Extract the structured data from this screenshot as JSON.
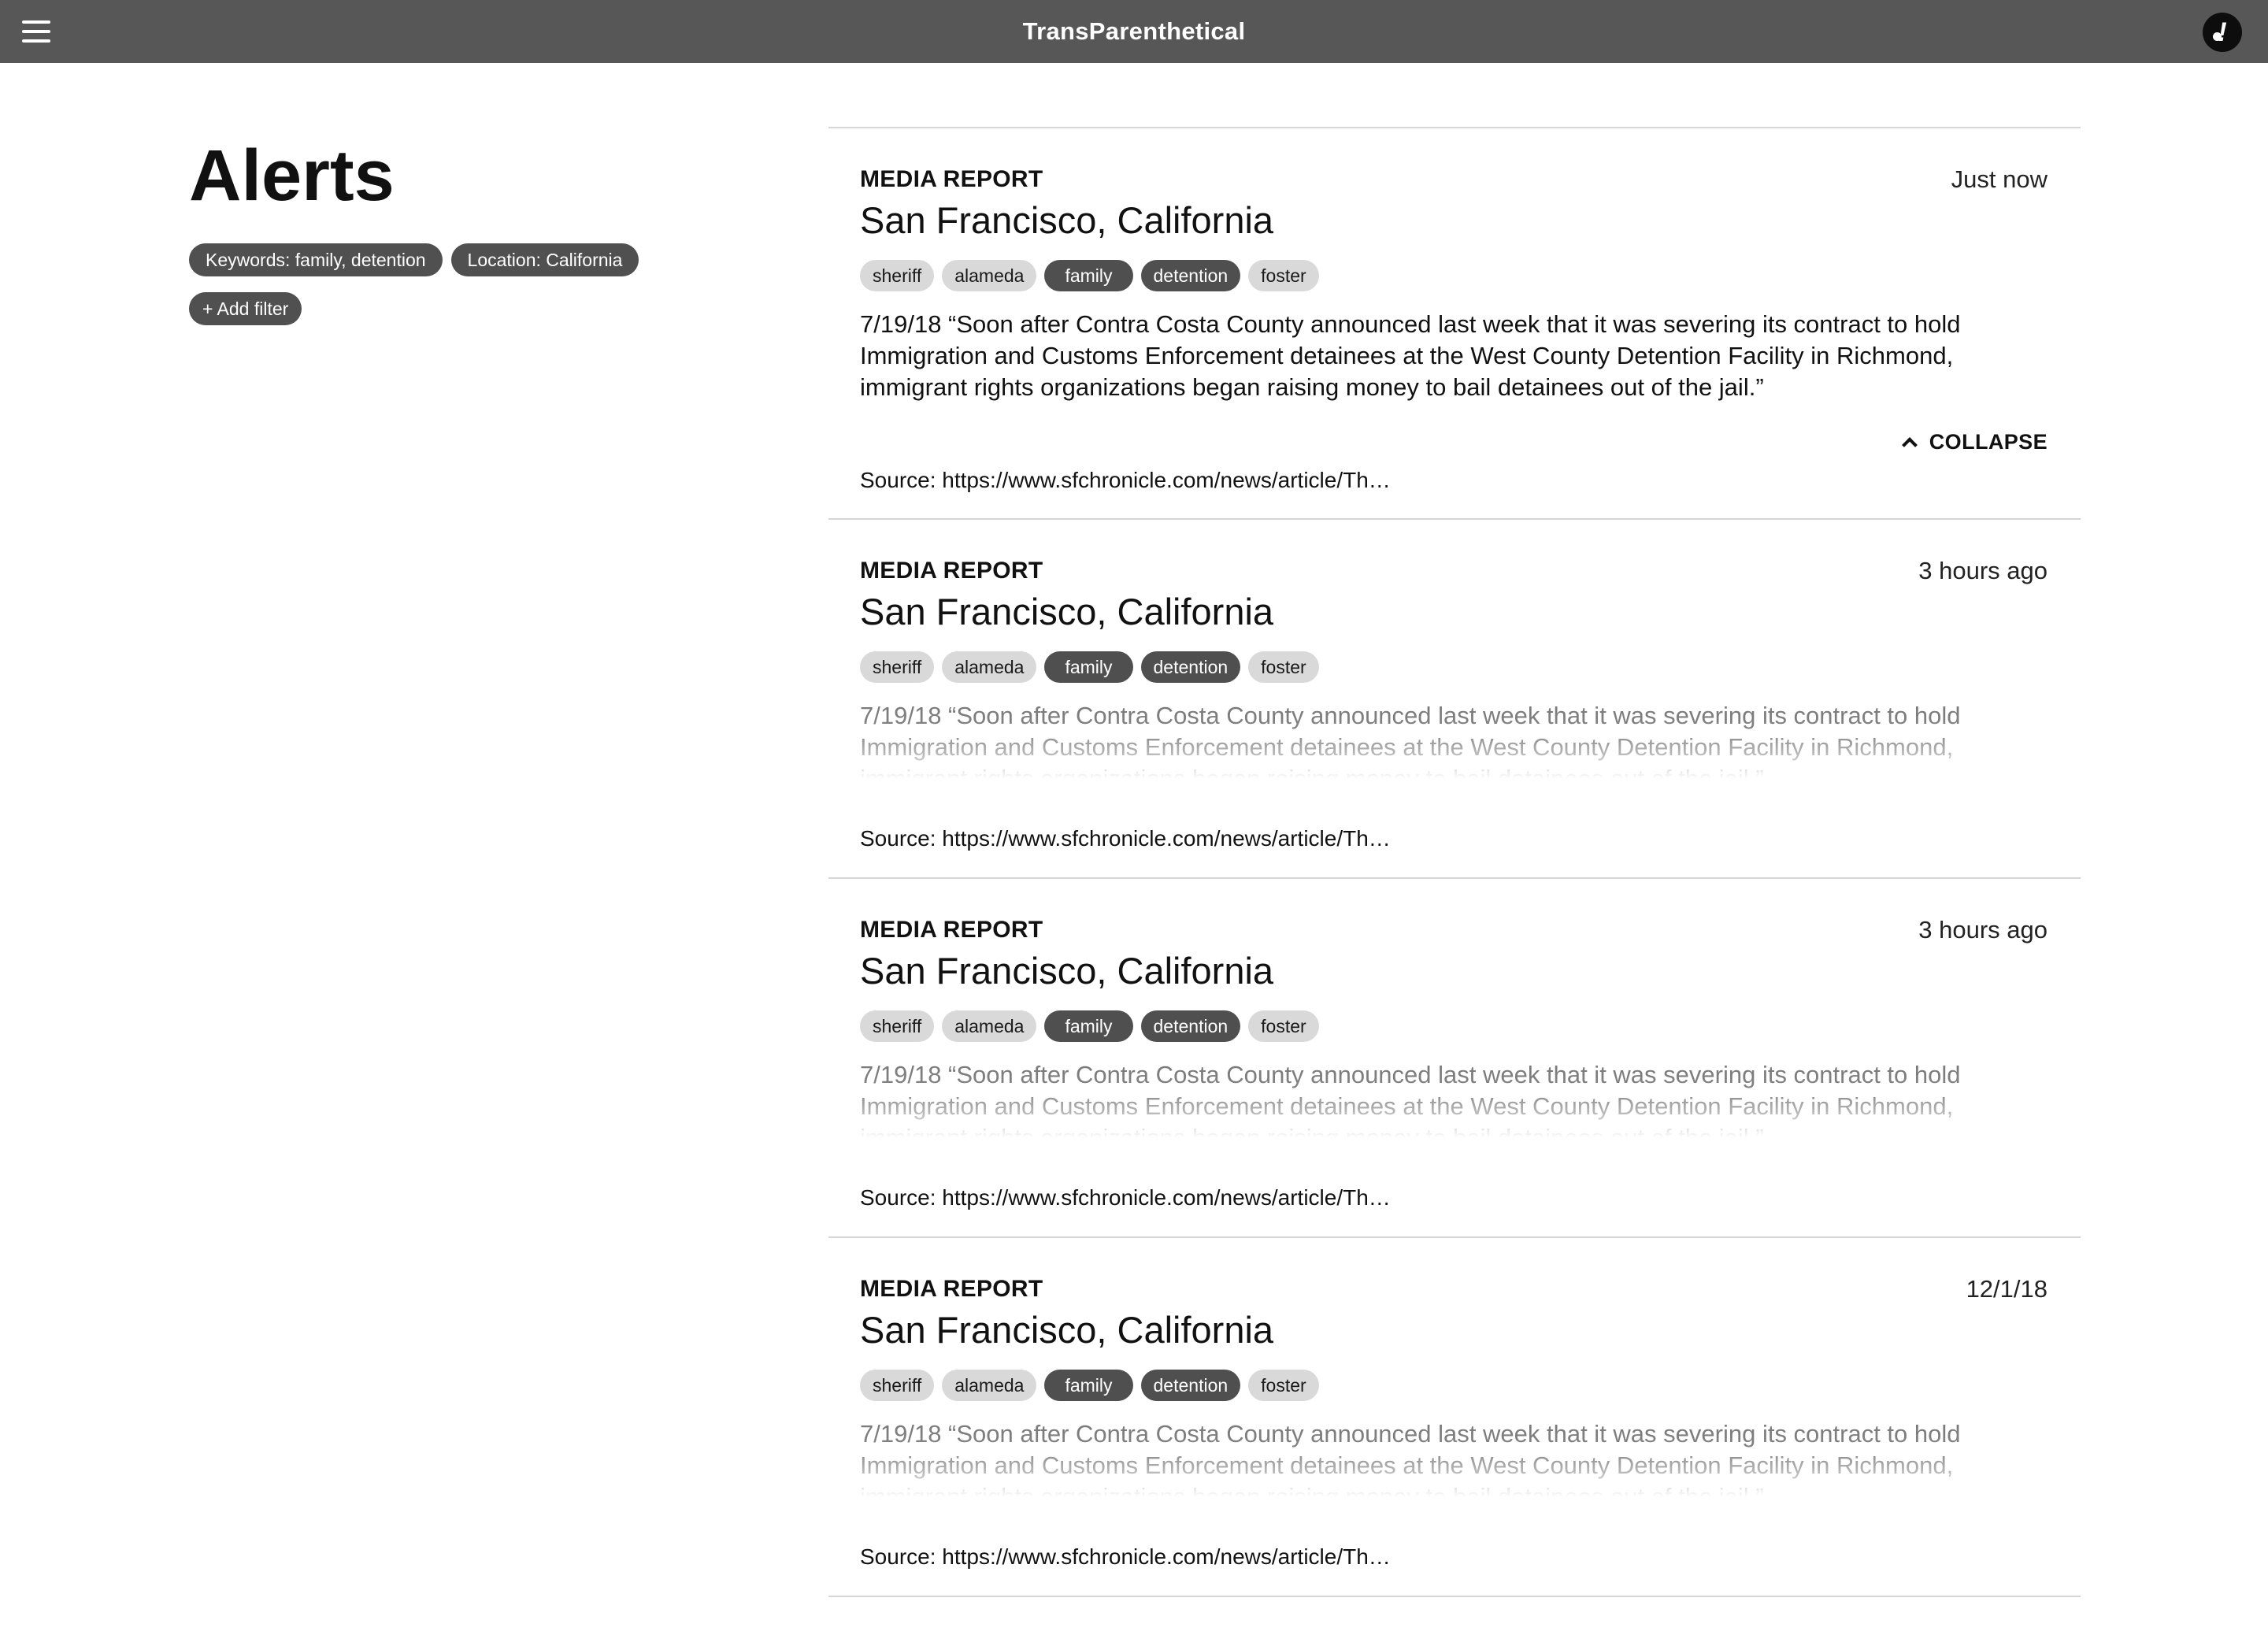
{
  "header": {
    "app_title": "TransParenthetical",
    "menu_icon": "hamburger-menu-icon",
    "avatar_icon": "user-avatar-icon"
  },
  "sidebar": {
    "title": "Alerts",
    "filters": [
      {
        "label": "Keywords: family, detention"
      },
      {
        "label": "Location: California"
      }
    ],
    "add_filter_label": "+ Add filter"
  },
  "cards": [
    {
      "type": "MEDIA REPORT",
      "time": "Just now",
      "location": "San Francisco, California",
      "tags": [
        {
          "label": "sheriff",
          "active": false
        },
        {
          "label": "alameda",
          "active": false
        },
        {
          "label": "family",
          "active": true
        },
        {
          "label": "detention",
          "active": true
        },
        {
          "label": "foster",
          "active": false
        }
      ],
      "excerpt": "7/19/18 “Soon after Contra Costa County announced last week that it was severing its contract to hold Immigration and Customs Enforcement detainees at the West County Detention Facility in Richmond, immigrant rights organizations began raising money to bail detainees out of the jail.”",
      "collapse_label": "COLLAPSE",
      "source": "Source: https://www.sfchronicle.com/news/article/Th…"
    },
    {
      "type": "MEDIA REPORT",
      "time": "3 hours ago",
      "location": "San Francisco, California",
      "tags": [
        {
          "label": "sheriff",
          "active": false
        },
        {
          "label": "alameda",
          "active": false
        },
        {
          "label": "family",
          "active": true
        },
        {
          "label": "detention",
          "active": true
        },
        {
          "label": "foster",
          "active": false
        }
      ],
      "excerpt": "7/19/18 “Soon after Contra Costa County announced last week that it was severing its contract to hold Immigration and Customs Enforcement detainees at the West County Detention Facility in Richmond, immigrant rights organizations began raising money to bail detainees out of the jail.”",
      "source": "Source: https://www.sfchronicle.com/news/article/Th…"
    },
    {
      "type": "MEDIA REPORT",
      "time": "3 hours ago",
      "location": "San Francisco, California",
      "tags": [
        {
          "label": "sheriff",
          "active": false
        },
        {
          "label": "alameda",
          "active": false
        },
        {
          "label": "family",
          "active": true
        },
        {
          "label": "detention",
          "active": true
        },
        {
          "label": "foster",
          "active": false
        }
      ],
      "excerpt": "7/19/18 “Soon after Contra Costa County announced last week that it was severing its contract to hold Immigration and Customs Enforcement detainees at the West County Detention Facility in Richmond, immigrant rights organizations began raising money to bail detainees out of the jail.”",
      "source": "Source: https://www.sfchronicle.com/news/article/Th…"
    },
    {
      "type": "MEDIA REPORT",
      "time": "12/1/18",
      "location": "San Francisco, California",
      "tags": [
        {
          "label": "sheriff",
          "active": false
        },
        {
          "label": "alameda",
          "active": false
        },
        {
          "label": "family",
          "active": true
        },
        {
          "label": "detention",
          "active": true
        },
        {
          "label": "foster",
          "active": false
        }
      ],
      "excerpt": "7/19/18 “Soon after Contra Costa County announced last week that it was severing its contract to hold Immigration and Customs Enforcement detainees at the West County Detention Facility in Richmond, immigrant rights organizations began raising money to bail detainees out of the jail.”",
      "source": "Source: https://www.sfchronicle.com/news/article/Th…"
    }
  ],
  "colors": {
    "topbar": "#575757",
    "chip_dark": "#505050",
    "tag_light": "#d9d9d9",
    "divider": "#d6d6d6"
  }
}
